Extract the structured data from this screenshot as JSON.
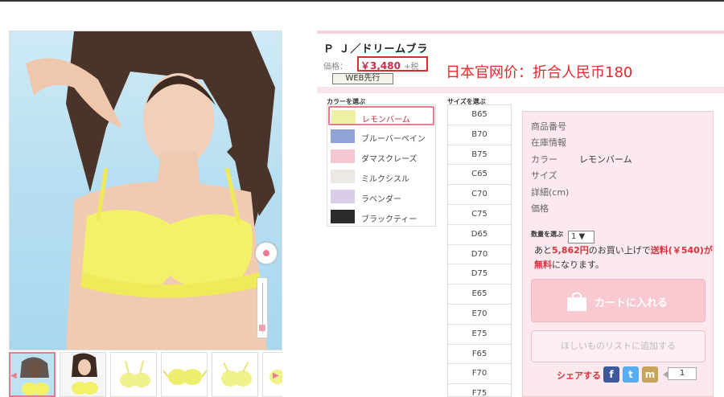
{
  "product": {
    "title": "Ｐ Ｊ／ドリームブラ",
    "price_label": "価格：",
    "price": "￥3,480",
    "tax_note": "+税",
    "web_badge": "WEB先行",
    "annotation_cn": "日本官网价：折合人民币180",
    "annotation_color": "#e02b2b"
  },
  "color_selector": {
    "heading": "カラーを選ぶ",
    "items": [
      {
        "label": "レモンバーム",
        "swatch": "#eef0a3",
        "selected": true
      },
      {
        "label": "ブルーバーベイン",
        "swatch": "#8fa3d6",
        "selected": false
      },
      {
        "label": "ダマスクレーズ",
        "swatch": "#f3c6d0",
        "selected": false
      },
      {
        "label": "ミルクシスル",
        "swatch": "#ece8e4",
        "selected": false
      },
      {
        "label": "ラベンダー",
        "swatch": "#d9cdea",
        "selected": false
      },
      {
        "label": "ブラックティー",
        "swatch": "#2b2b2b",
        "selected": false
      }
    ]
  },
  "size_selector": {
    "heading": "サイズを選ぶ",
    "items": [
      "B65",
      "B70",
      "B75",
      "C65",
      "C70",
      "C75",
      "D65",
      "D70",
      "D75",
      "E65",
      "E70",
      "E75",
      "F65",
      "F70",
      "F75"
    ]
  },
  "details": {
    "rows": [
      {
        "label": "商品番号",
        "value": ""
      },
      {
        "label": "在庫情報",
        "value": ""
      },
      {
        "label": "カラー",
        "value": "レモンバーム"
      },
      {
        "label": "サイズ",
        "value": ""
      },
      {
        "label": "詳細(cm)",
        "value": ""
      },
      {
        "label": "価格",
        "value": ""
      }
    ],
    "quantity_label": "数量を選ぶ",
    "quantity_value": "1 ▼",
    "shipping_prefix": "あと",
    "shipping_amount": "5,862円",
    "shipping_mid": "のお買い上げで",
    "shipping_fee": "送料(￥540)",
    "shipping_connector": "が",
    "shipping_free": "無料",
    "shipping_suffix": "になります。",
    "cart_button": "カートに入れる",
    "wishlist_button": "ほしいものリストに追加する",
    "share_label": "シェアする",
    "share_icons": [
      {
        "name": "facebook-icon",
        "glyph": "f",
        "color": "#3b5998"
      },
      {
        "name": "twitter-icon",
        "glyph": "t",
        "color": "#55acee"
      },
      {
        "name": "mixi-icon",
        "glyph": "m",
        "color": "#c9a25b"
      }
    ],
    "share_count": "1"
  },
  "accent_color": "#e5798e"
}
